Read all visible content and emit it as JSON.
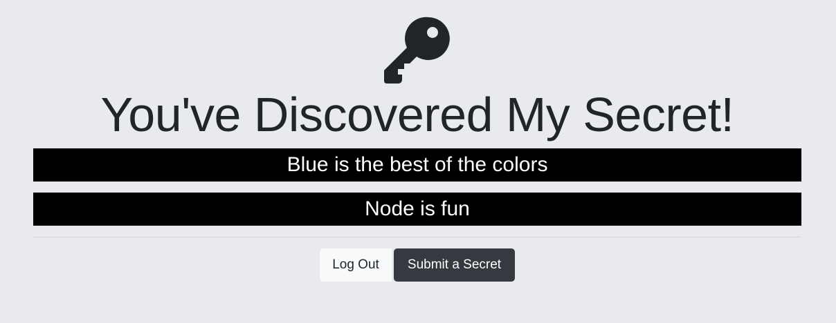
{
  "icon": {
    "name": "key-icon",
    "color": "#212529"
  },
  "page": {
    "title": "You've Discovered My Secret!"
  },
  "secrets": [
    "Blue is the best of the colors",
    "Node is fun"
  ],
  "buttons": {
    "logout_label": "Log Out",
    "submit_label": "Submit a Secret"
  },
  "colors": {
    "background": "#e9eaee",
    "secret_background": "#000000",
    "secret_text": "#ffffff",
    "button_light": "#f8f9fa",
    "button_dark": "#343a40"
  }
}
